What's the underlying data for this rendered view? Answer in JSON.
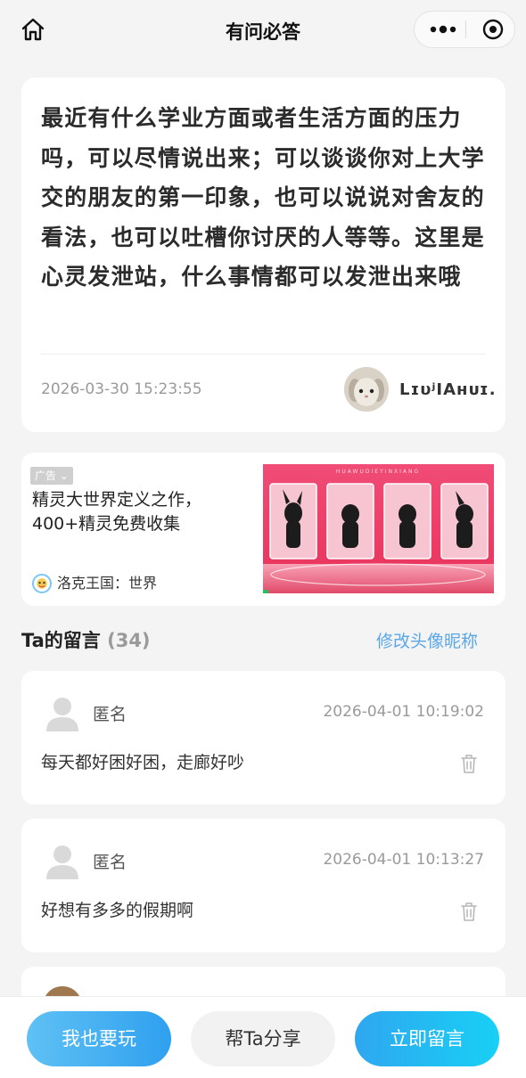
{
  "nav": {
    "title": "有问必答",
    "home_icon": "home-icon",
    "more_icon": "more-dots-icon",
    "close_icon": "target-circle-icon"
  },
  "question": {
    "text": "最近有什么学业方面或者生活方面的压力吗，可以尽情说出来；可以谈谈你对上大学交的朋友的第一印象，也可以说说对舍友的看法，也可以吐槽你讨厌的人等等。这里是心灵发泄站，什么事情都可以发泄出来哦",
    "time": "2026-03-30 15:23:55",
    "author": "LɪυʲIAʜᴜɪ."
  },
  "ad": {
    "tag": "广告",
    "title": "精灵大世界定义之作，400+精灵免费收集",
    "brand": "洛克王国：世界",
    "banner_text": "HUAWUDIEYINXIANG"
  },
  "messages": {
    "title": "Ta的留言",
    "count": "(34)",
    "edit_label": "修改头像昵称",
    "items": [
      {
        "name": "匿名",
        "time": "2026-04-01 10:19:02",
        "text": "每天都好困好困，走廊好吵"
      },
      {
        "name": "匿名",
        "time": "2026-04-01 10:13:27",
        "text": "好想有多多的假期啊"
      }
    ]
  },
  "bottom": {
    "play_label": "我也要玩",
    "share_label": "帮Ta分享",
    "reply_label": "立即留言"
  },
  "colors": {
    "accent": "#2fa0ef",
    "link": "#5aa7e8",
    "background": "#f4f4f4"
  }
}
